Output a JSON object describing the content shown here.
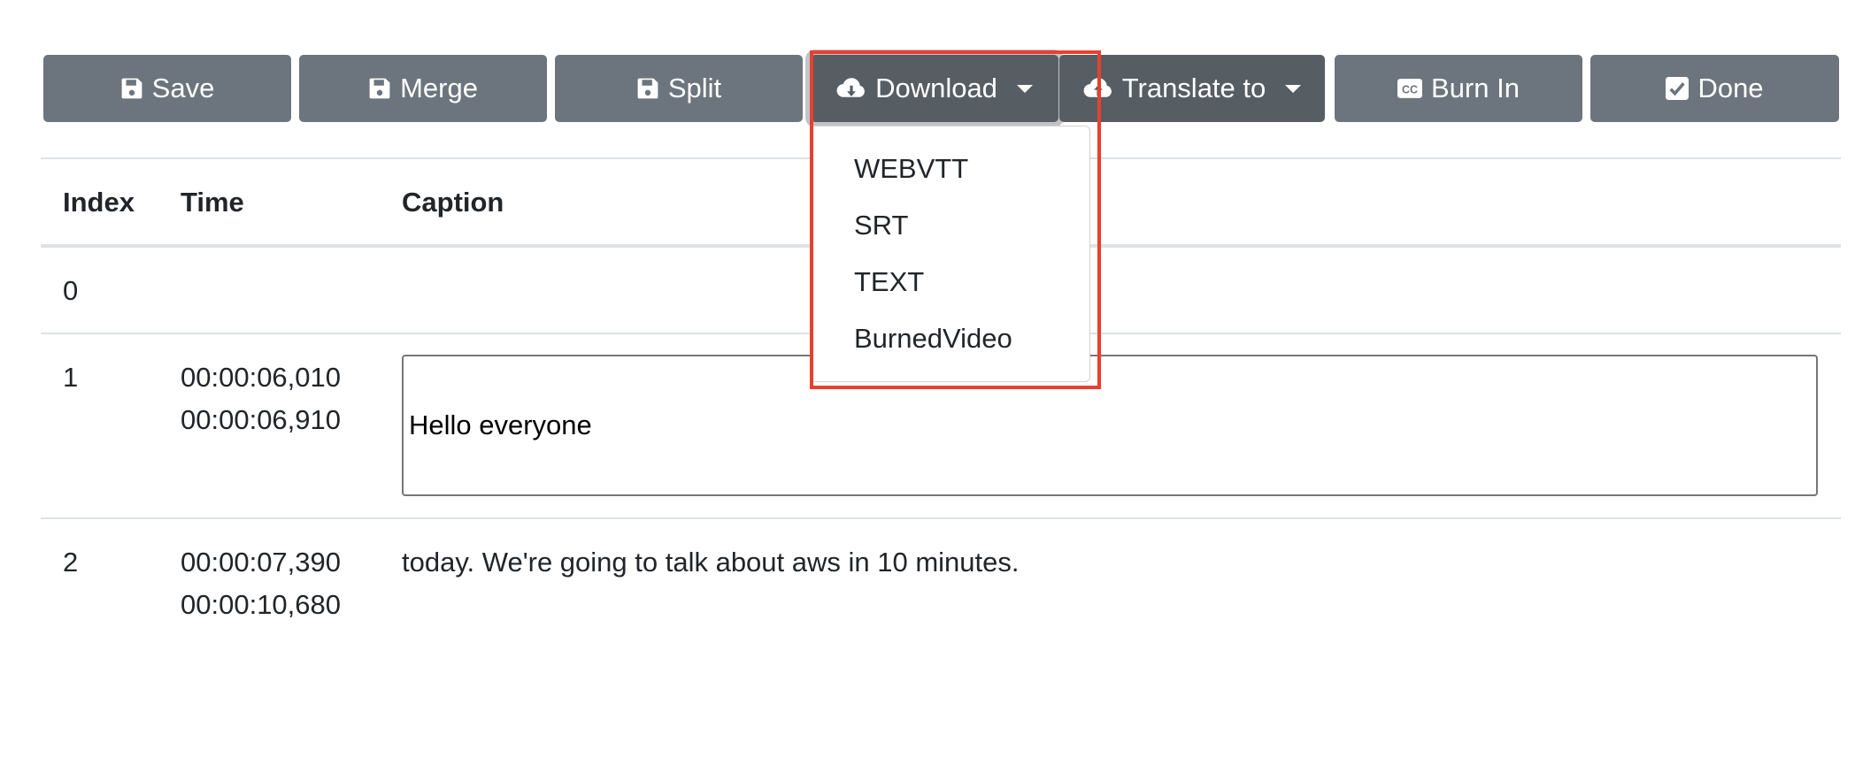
{
  "toolbar": {
    "buttons": [
      {
        "label": "Save",
        "icon": "floppy-disk-icon"
      },
      {
        "label": "Merge",
        "icon": "floppy-disk-icon"
      },
      {
        "label": "Split",
        "icon": "floppy-disk-icon"
      },
      {
        "label": "Download",
        "icon": "cloud-download-icon",
        "dropdown": true
      },
      {
        "label": "Translate to",
        "icon": "cloud-upload-icon",
        "dropdown": true
      },
      {
        "label": "Burn In",
        "icon": "closed-captions-icon"
      },
      {
        "label": "Done",
        "icon": "check-square-icon"
      }
    ]
  },
  "download_menu": {
    "items": [
      "WEBVTT",
      "SRT",
      "TEXT",
      "BurnedVideo"
    ]
  },
  "table": {
    "headers": {
      "index": "Index",
      "time": "Time",
      "caption": "Caption"
    },
    "rows": [
      {
        "index": "0",
        "start": "",
        "end": "",
        "caption": ""
      },
      {
        "index": "1",
        "start": "00:00:06,010",
        "end": "00:00:06,910",
        "caption": "Hello everyone",
        "editing": true
      },
      {
        "index": "2",
        "start": "00:00:07,390",
        "end": "00:00:10,680",
        "caption": "today. We're going to talk about aws in 10 minutes."
      }
    ]
  },
  "colors": {
    "button_bg": "#6c757d",
    "button_active_bg": "#565e64",
    "highlight_border": "#e8402e",
    "text": "#212529"
  }
}
